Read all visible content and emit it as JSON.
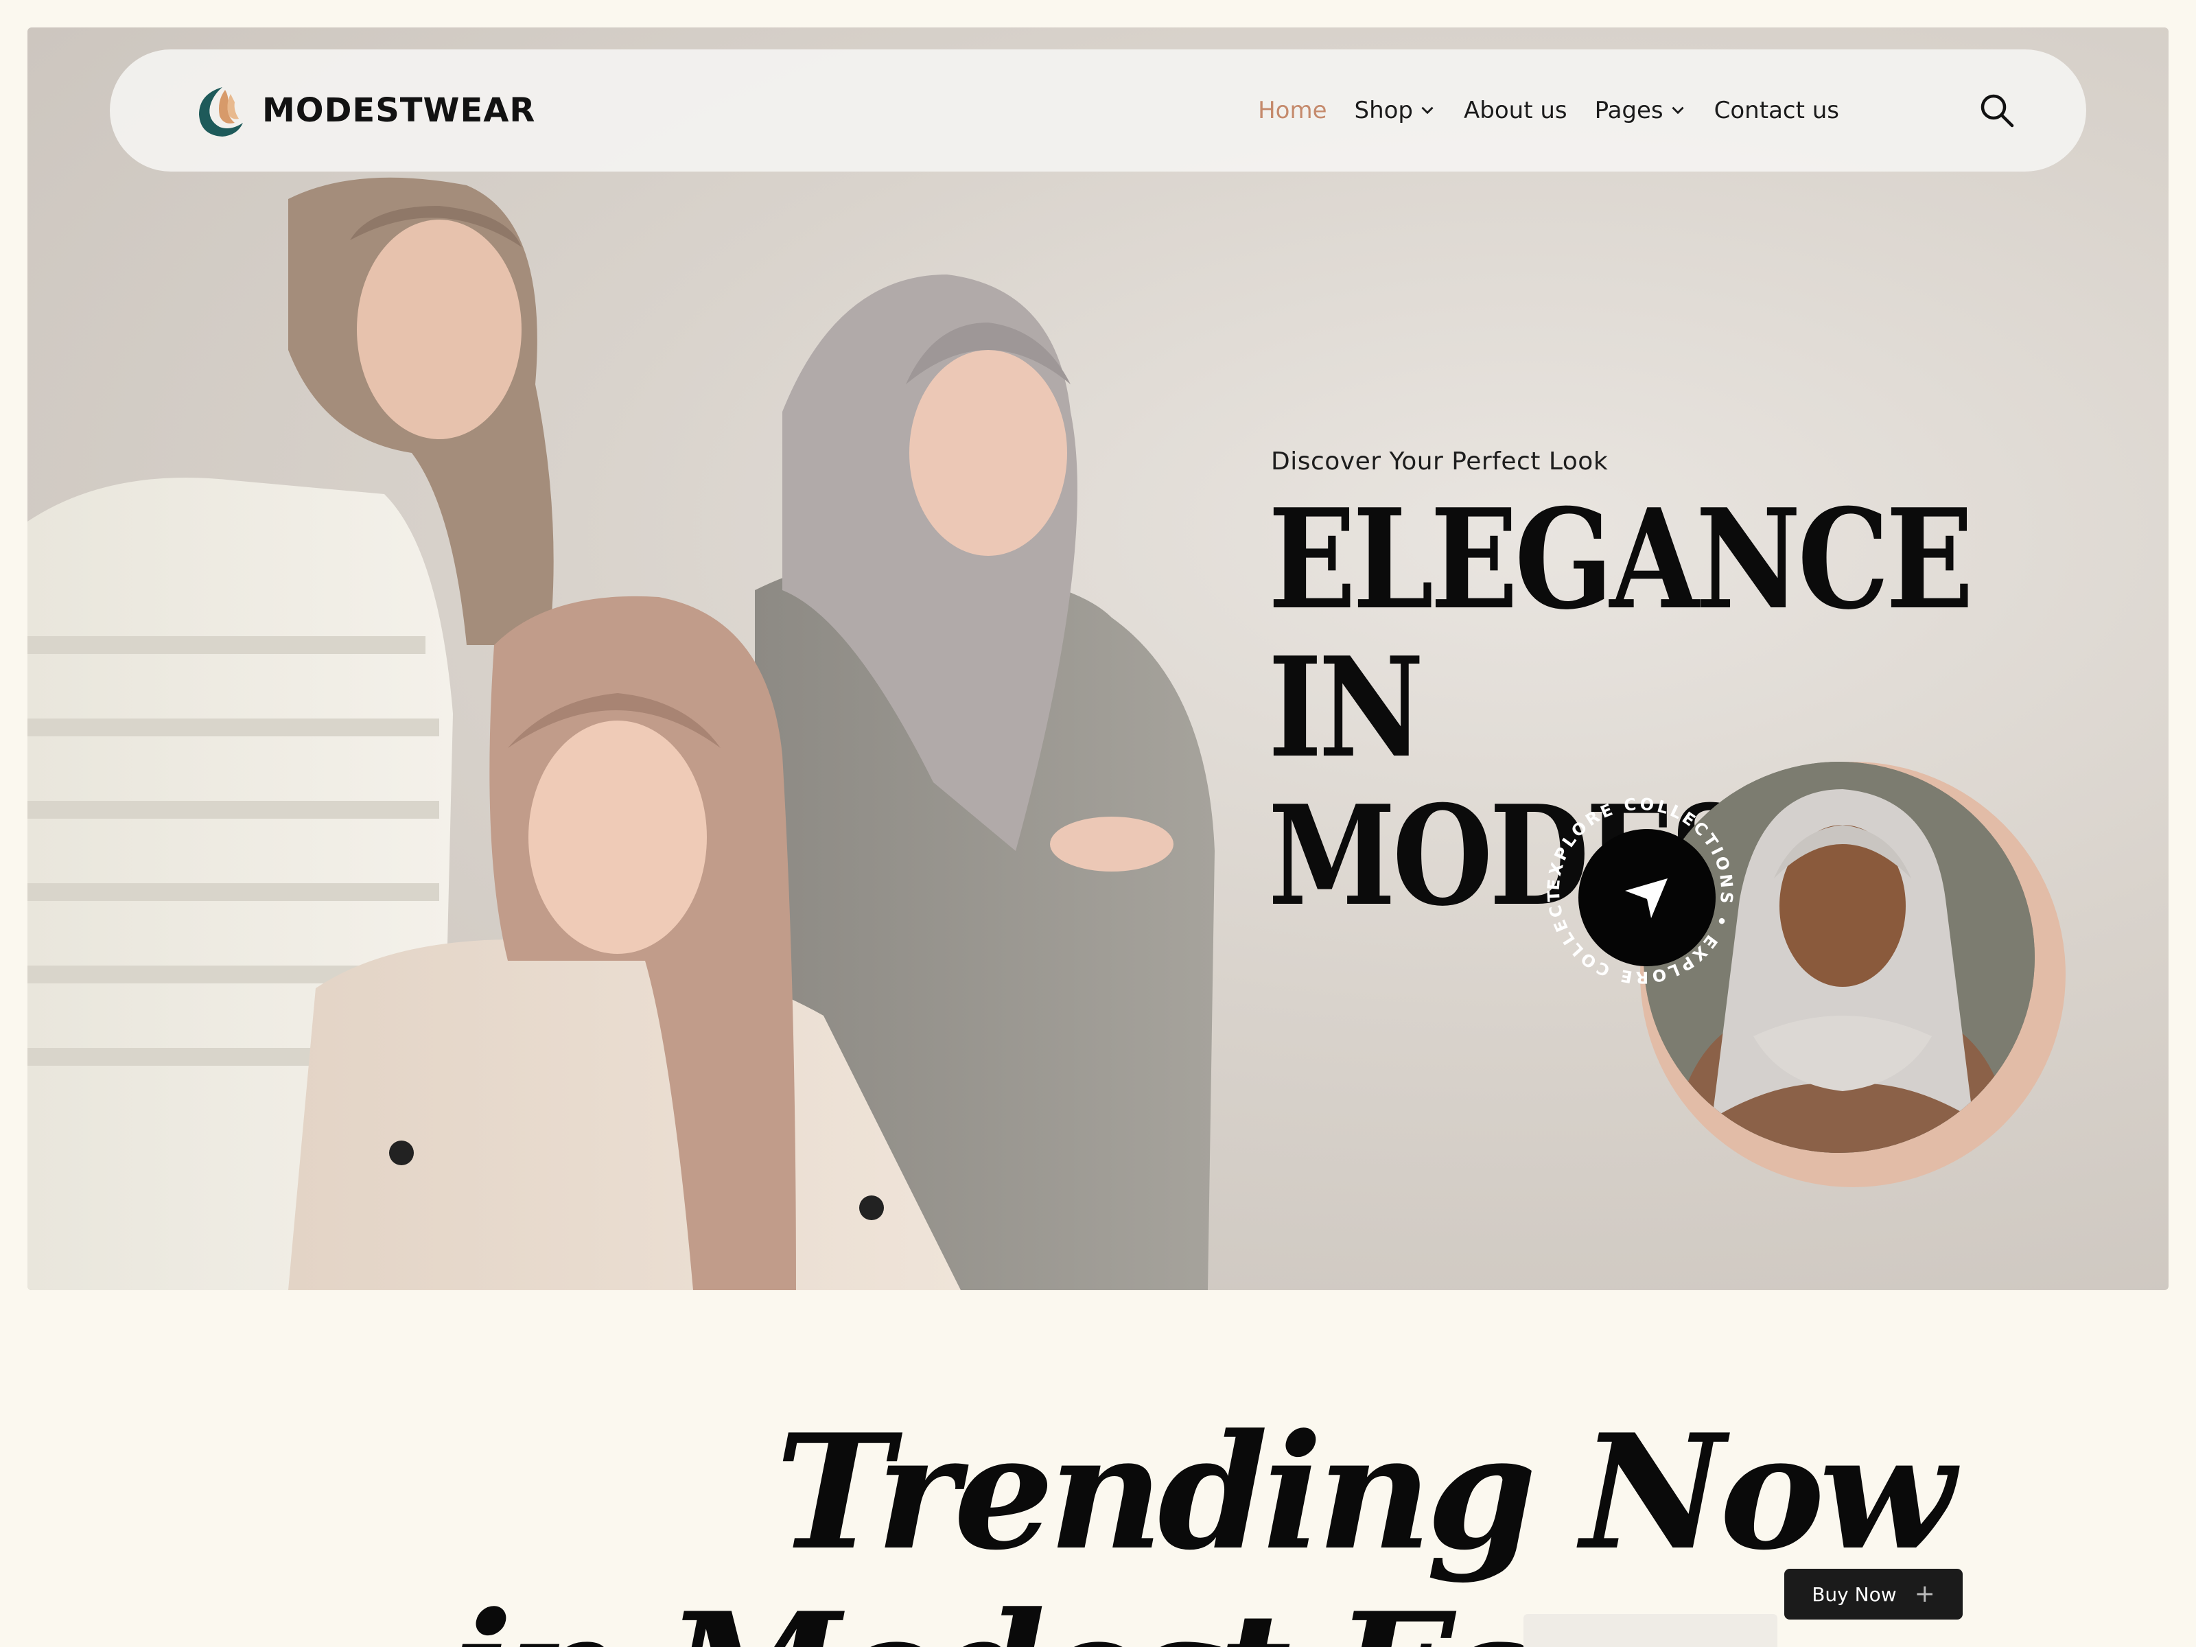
{
  "brand": {
    "name": "MODESTWEAR",
    "accent": "#c58a6c",
    "logo_colors": [
      "#1e5a5a",
      "#d79a6a"
    ]
  },
  "nav": {
    "items": [
      {
        "label": "Home",
        "active": true,
        "has_dropdown": false
      },
      {
        "label": "Shop",
        "active": false,
        "has_dropdown": true
      },
      {
        "label": "About us",
        "active": false,
        "has_dropdown": false
      },
      {
        "label": "Pages",
        "active": false,
        "has_dropdown": true
      },
      {
        "label": "Contact us",
        "active": false,
        "has_dropdown": false
      }
    ],
    "search_icon": "search-icon"
  },
  "hero": {
    "eyebrow": "Discover Your Perfect Look",
    "title_line1": "ELEGANCE IN",
    "title_line2": "MODESTY",
    "explore_ring_text": "EXPLORE COLLECTIONS • EXPLORE COLLECTIONS • ",
    "explore_icon": "send-arrow-icon",
    "blob_color": "#e2bca7"
  },
  "trending": {
    "line1": "Trending Now",
    "line2": "in Modest Fashion",
    "buy_label": "Buy Now",
    "buy_icon": "plus-icon"
  }
}
